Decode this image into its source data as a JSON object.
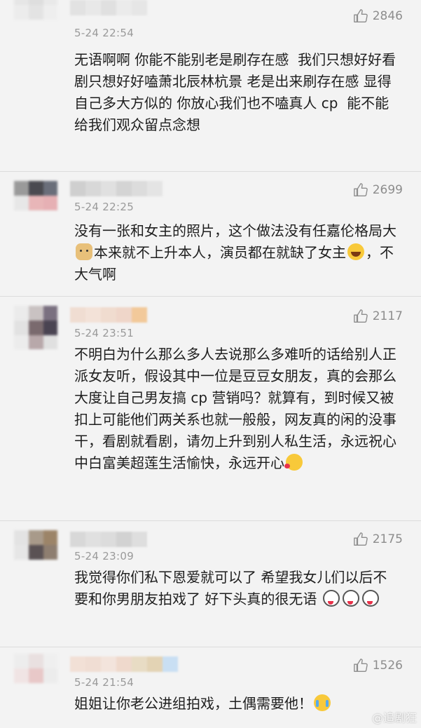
{
  "comments": [
    {
      "time": "5-24 22:54",
      "likes": "2846",
      "text": "无语啊啊 你能不能别老是刷存在感  我们只想好好看剧只想好好嗑萧北辰林杭景 老是出来刷存在感 显得自己多大方似的 你放心我们也不嗑真人 cp  能不能给我们观众留点念想",
      "emojis": []
    },
    {
      "time": "5-24 22:25",
      "likes": "2699",
      "text_parts": [
        "没有一张和女主的照片，这个做法没有任嘉伦格局大",
        "本来就不上升本人，演员都在就缺了女主",
        "，不大气啊"
      ],
      "emojis": [
        "doge-icon",
        "laugh-cry-icon"
      ]
    },
    {
      "time": "5-24 23:51",
      "likes": "2117",
      "text_parts": [
        "不明白为什么那么多人去说那么多难听的话给别人正派女友听，假设其中一位是豆豆女朋友，真的会那么大度让自己男友搞 cp 营销吗？就算有，到时候又被扣上可能他们两关系也就一般般，网友真的闲的没事干，看剧就看剧，请勿上升到别人私生活，永远祝心中白富美超莲生活愉快，永远开心"
      ],
      "emojis": [
        "kiss-icon"
      ]
    },
    {
      "time": "5-24 23:09",
      "likes": "2175",
      "text_parts": [
        "我觉得你们私下恩爱就可以了 希望我女儿们以后不要和你男朋友拍戏了 好下头真的很无语 "
      ],
      "emojis": [
        "husky-icon",
        "husky-icon",
        "husky-icon"
      ]
    },
    {
      "time": "5-24 21:54",
      "likes": "1526",
      "text_parts": [
        "姐姐让你老公进组拍戏，土偶需要他！"
      ],
      "emojis": [
        "cry-icon"
      ]
    }
  ],
  "colors": {
    "background": "#f3f3f3",
    "meta": "#9a9a9a",
    "text": "#1e1e1e"
  },
  "watermark": "@追剧狂"
}
